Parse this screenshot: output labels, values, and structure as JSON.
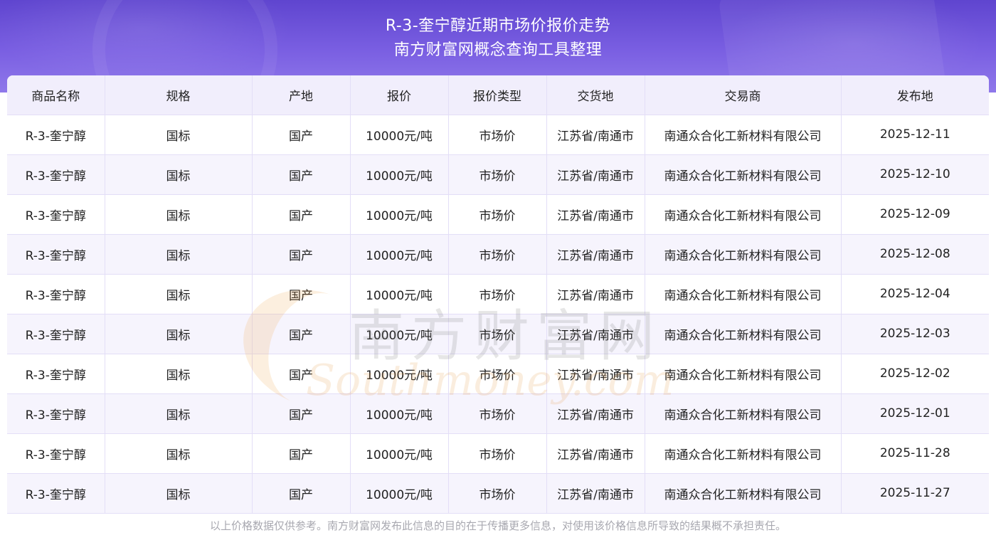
{
  "header": {
    "title_line1": "R-3-奎宁醇近期市场价报价走势",
    "title_line2": "南方财富网概念查询工具整理"
  },
  "table": {
    "columns": [
      "商品名称",
      "规格",
      "产地",
      "报价",
      "报价类型",
      "交货地",
      "交易商",
      "发布地"
    ],
    "rows": [
      [
        "R-3-奎宁醇",
        "国标",
        "国产",
        "10000元/吨",
        "市场价",
        "江苏省/南通市",
        "南通众合化工新材料有限公司",
        "2025-12-11"
      ],
      [
        "R-3-奎宁醇",
        "国标",
        "国产",
        "10000元/吨",
        "市场价",
        "江苏省/南通市",
        "南通众合化工新材料有限公司",
        "2025-12-10"
      ],
      [
        "R-3-奎宁醇",
        "国标",
        "国产",
        "10000元/吨",
        "市场价",
        "江苏省/南通市",
        "南通众合化工新材料有限公司",
        "2025-12-09"
      ],
      [
        "R-3-奎宁醇",
        "国标",
        "国产",
        "10000元/吨",
        "市场价",
        "江苏省/南通市",
        "南通众合化工新材料有限公司",
        "2025-12-08"
      ],
      [
        "R-3-奎宁醇",
        "国标",
        "国产",
        "10000元/吨",
        "市场价",
        "江苏省/南通市",
        "南通众合化工新材料有限公司",
        "2025-12-04"
      ],
      [
        "R-3-奎宁醇",
        "国标",
        "国产",
        "10000元/吨",
        "市场价",
        "江苏省/南通市",
        "南通众合化工新材料有限公司",
        "2025-12-03"
      ],
      [
        "R-3-奎宁醇",
        "国标",
        "国产",
        "10000元/吨",
        "市场价",
        "江苏省/南通市",
        "南通众合化工新材料有限公司",
        "2025-12-02"
      ],
      [
        "R-3-奎宁醇",
        "国标",
        "国产",
        "10000元/吨",
        "市场价",
        "江苏省/南通市",
        "南通众合化工新材料有限公司",
        "2025-12-01"
      ],
      [
        "R-3-奎宁醇",
        "国标",
        "国产",
        "10000元/吨",
        "市场价",
        "江苏省/南通市",
        "南通众合化工新材料有限公司",
        "2025-11-28"
      ],
      [
        "R-3-奎宁醇",
        "国标",
        "国产",
        "10000元/吨",
        "市场价",
        "江苏省/南通市",
        "南通众合化工新材料有限公司",
        "2025-11-27"
      ]
    ]
  },
  "disclaimer": "以上价格数据仅供参考。南方财富网发布此信息的目的在于传播更多信息，对使用该价格信息所导致的结果概不承担责任。",
  "watermark": {
    "cn": "南方财富网",
    "en": "Southmoney.com"
  },
  "colors": {
    "header_bg": "#7a5fe2",
    "table_head_bg": "#f1eefc",
    "row_alt_bg": "#f6f4fd",
    "border": "#e3def7",
    "disclaimer_text": "#a8a8b0"
  }
}
